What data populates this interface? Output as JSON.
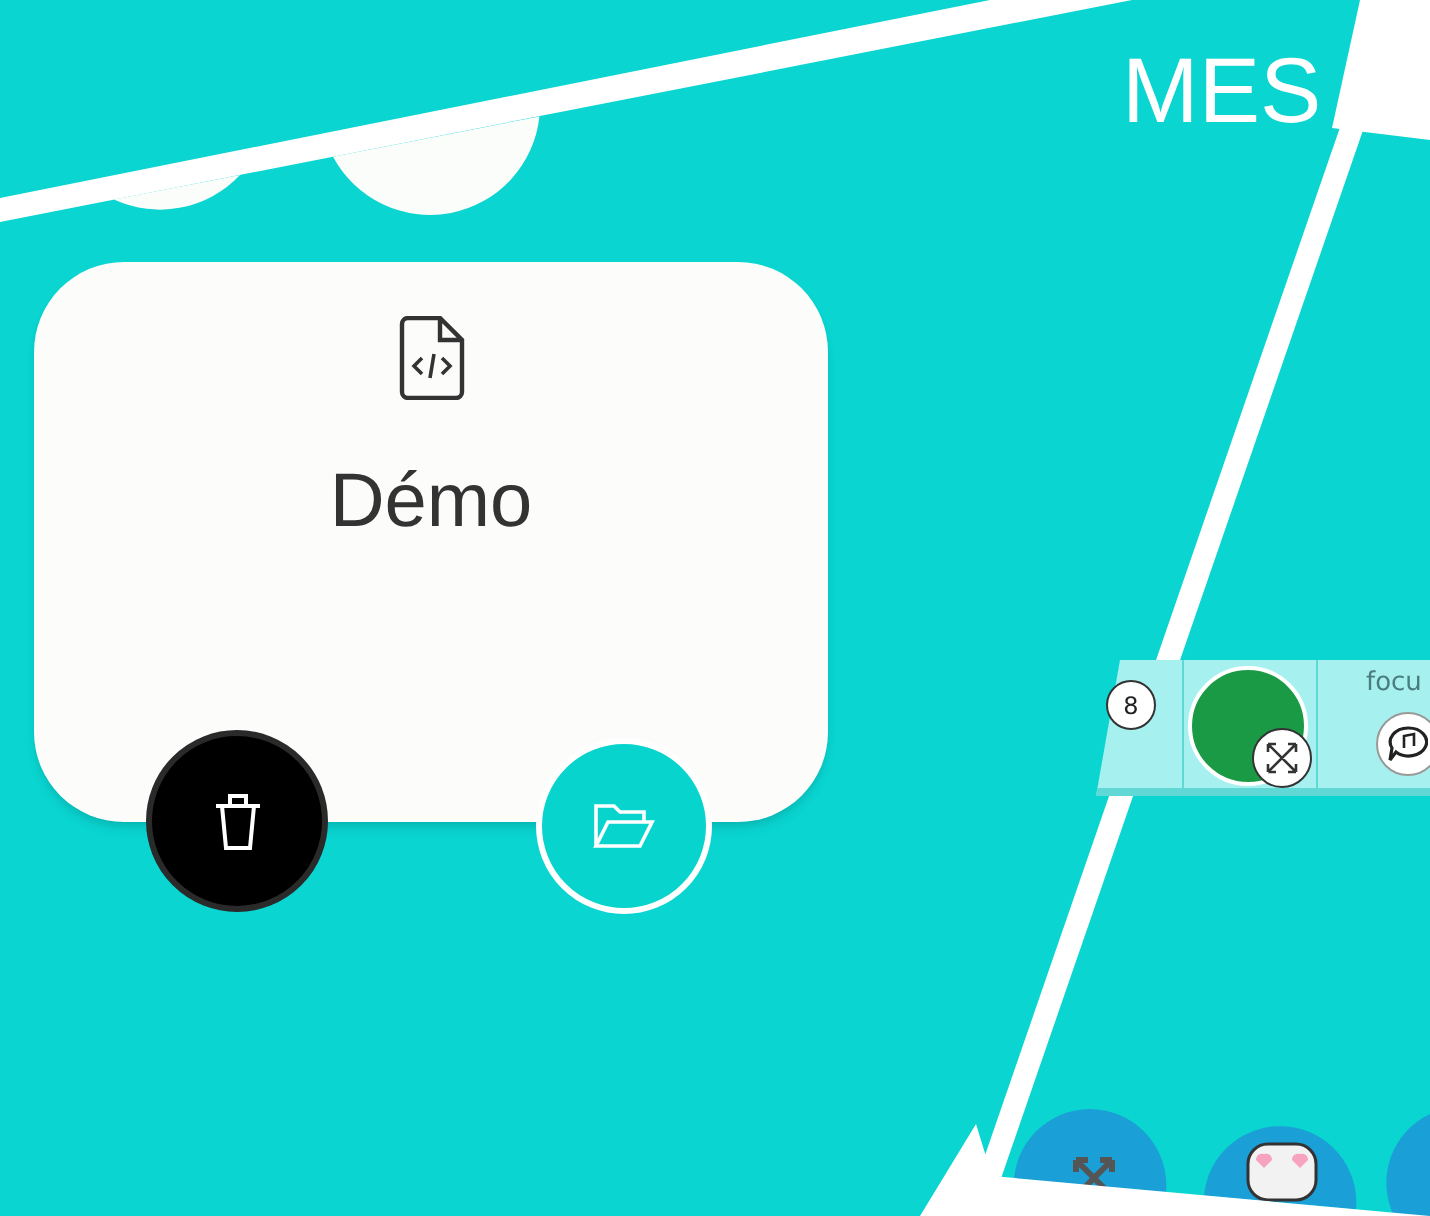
{
  "header": {
    "title": "MES"
  },
  "project_card": {
    "name": "Démo"
  },
  "block_strip": {
    "badge": "8",
    "label": "focu"
  }
}
